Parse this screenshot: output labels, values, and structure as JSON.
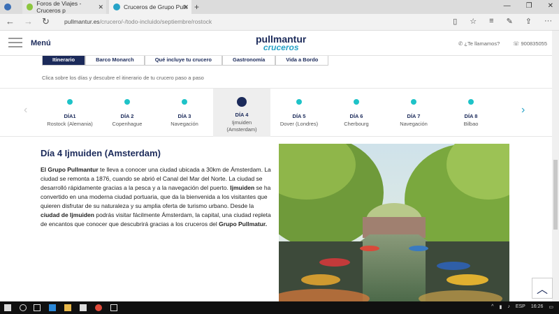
{
  "browser": {
    "tabs": [
      {
        "label": "",
        "fav": "#3b6fb6"
      },
      {
        "label": "Foros de Viajes - Cruceros p",
        "fav": "#8cc63f"
      },
      {
        "label": "Cruceros de Grupo Pullı",
        "fav": "#27a3c7"
      }
    ],
    "url_domain": "pullmantur.es",
    "url_path": "/crucero/-/todo-incluido/septiembre/rostock"
  },
  "site": {
    "menu_label": "Menú",
    "logo_top": "pullmantur",
    "logo_bottom": "cruceros",
    "call_label": "¿Te llamamos?",
    "phone": "900835055"
  },
  "subtabs": [
    "Itinerario",
    "Barco Monarch",
    "Qué incluye tu crucero",
    "Gastronomía",
    "Vida a Bordo"
  ],
  "hint": "Clica sobre los días y descubre el itinerario de tu crucero paso a paso",
  "days": [
    {
      "label": "DÍA1",
      "place": "Rostock (Alemania)"
    },
    {
      "label": "DÍA 2",
      "place": "Copenhague"
    },
    {
      "label": "DÍA 3",
      "place": "Navegación"
    },
    {
      "label": "DÍA 4",
      "place": "Ijmuiden (Amsterdam)"
    },
    {
      "label": "DÍA 5",
      "place": "Dover (Londres)"
    },
    {
      "label": "DÍA 6",
      "place": "Cherbourg"
    },
    {
      "label": "DÍA 7",
      "place": "Navegación"
    },
    {
      "label": "DÍA 8",
      "place": "Bilbao"
    }
  ],
  "content": {
    "title": "Día 4 Ijmuiden (Amsterdam)",
    "p1_bold": "El Grupo Pullmantur",
    "p1": " te lleva a conocer una ciudad ubicada a 30km de Ámsterdam. La ciudad se remonta a 1876, cuando se abrió el Canal del Mar del Norte. La ciudad se desarrolló rápidamente gracias a la pesca y a la navegación del puerto. ",
    "p2_bold": "Ijmuiden",
    "p2": " se ha convertido en una moderna ciudad portuaria, que da la bienvenida a los visitantes que quieren disfrutar de su naturaleza y su amplia oferta de turismo urbano. Desde la ",
    "p3_bold": "ciudad de Ijmuiden",
    "p3": " podrás visitar fácilmente Ámsterdam, la capital, una ciudad repleta de encantos que conocer que descubrirá gracias a los cruceros del ",
    "p4_bold": "Grupo Pullmatur."
  },
  "taskbar": {
    "lang": "ESP",
    "time": "16:26"
  }
}
